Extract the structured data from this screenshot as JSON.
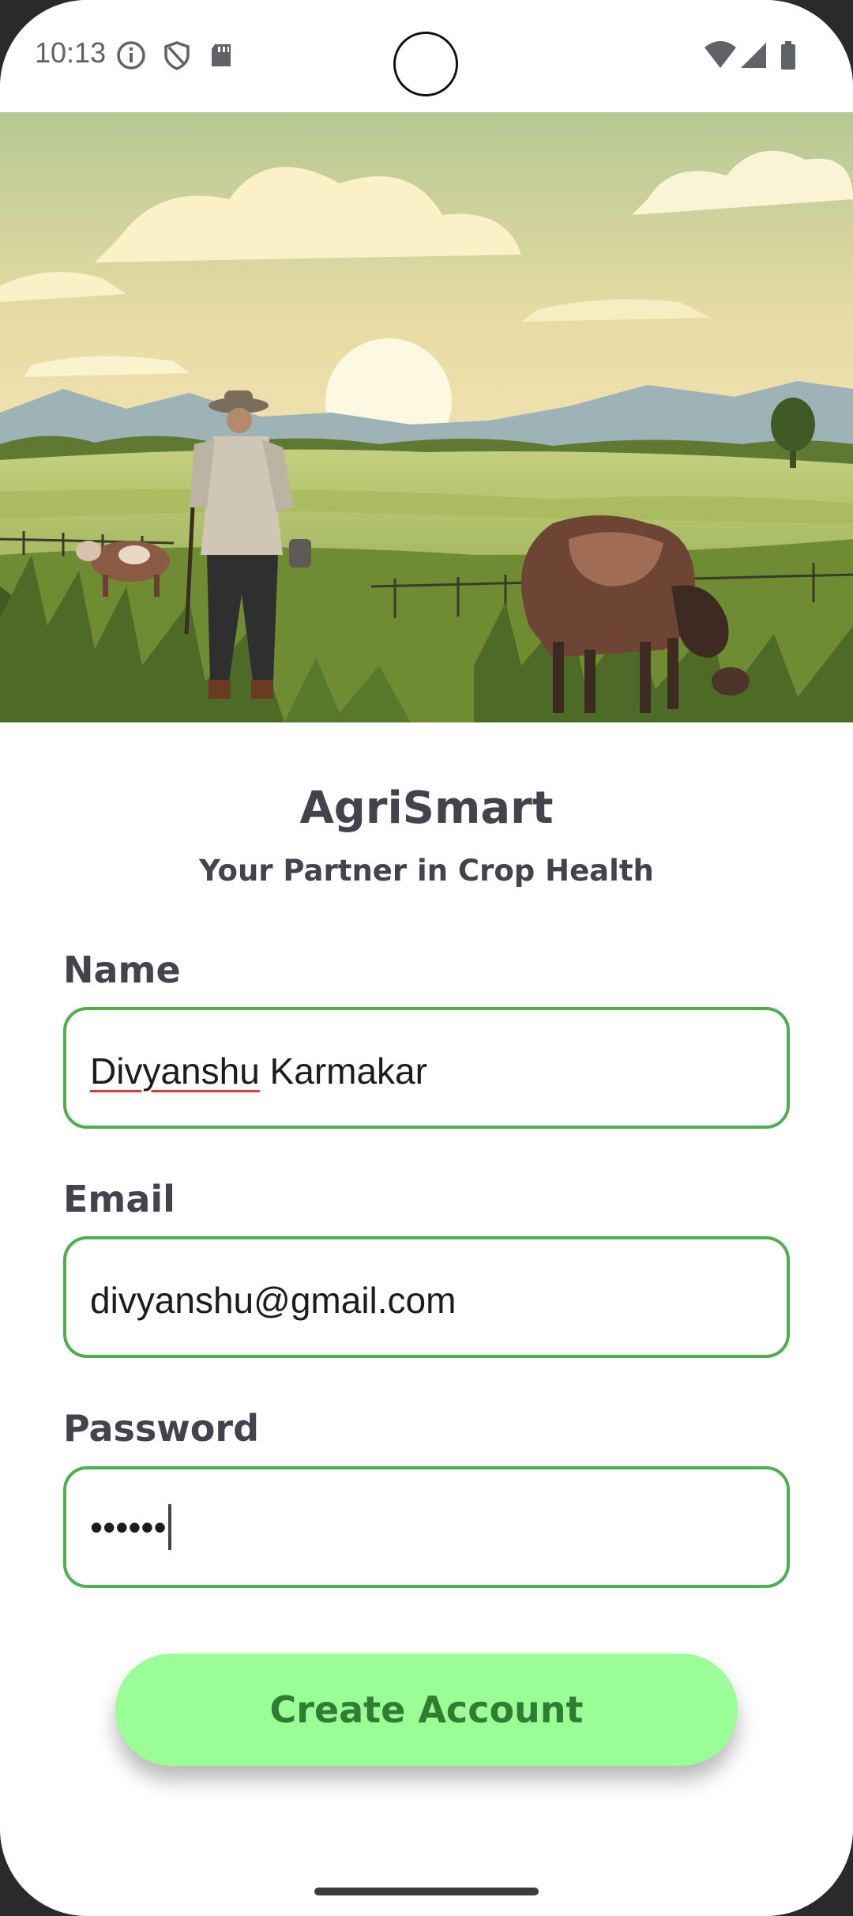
{
  "status_bar": {
    "time": "10:13",
    "icons": [
      "info-icon",
      "shield-icon",
      "sd-card-icon",
      "wifi-icon",
      "signal-icon",
      "battery-icon"
    ]
  },
  "header": {
    "app_title": "AgriSmart",
    "tagline": "Your Partner in Crop Health"
  },
  "form": {
    "name": {
      "label": "Name",
      "value_first": "Divyanshu",
      "value_rest": " Karmakar"
    },
    "email": {
      "label": "Email",
      "value": "divyanshu@gmail.com"
    },
    "password": {
      "label": "Password",
      "value": "••••••"
    },
    "submit_label": "Create Account"
  },
  "colors": {
    "accent_border": "#4caf50",
    "button_bg": "#9afd95",
    "button_text": "#2e7d32",
    "text": "#45424e"
  }
}
